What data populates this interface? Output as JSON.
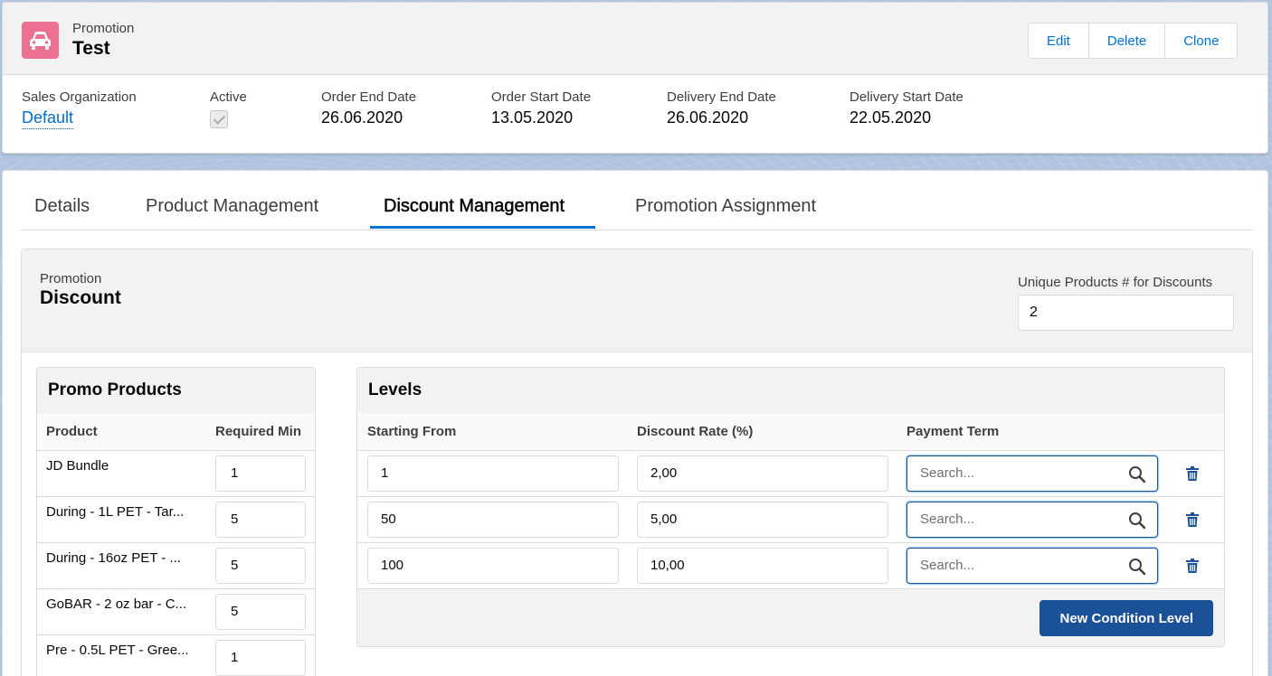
{
  "header": {
    "entity_label": "Promotion",
    "record_title": "Test",
    "icon": "car-icon",
    "icon_color": "#eb7092",
    "actions": {
      "edit": "Edit",
      "delete": "Delete",
      "clone": "Clone"
    },
    "fields": {
      "sales_org_label": "Sales Organization",
      "sales_org_value": "Default",
      "active_label": "Active",
      "active_checked": true,
      "order_end_label": "Order End Date",
      "order_end_value": "26.06.2020",
      "order_start_label": "Order Start Date",
      "order_start_value": "13.05.2020",
      "delivery_end_label": "Delivery End Date",
      "delivery_end_value": "26.06.2020",
      "delivery_start_label": "Delivery Start Date",
      "delivery_start_value": "22.05.2020"
    }
  },
  "tabs": {
    "details": "Details",
    "product_management": "Product Management",
    "discount_management": "Discount Management",
    "promotion_assignment": "Promotion Assignment",
    "active": "discount_management"
  },
  "discount": {
    "label": "Promotion",
    "title": "Discount",
    "unique_products_label": "Unique Products # for Discounts",
    "unique_products_value": "2"
  },
  "promo_products": {
    "title": "Promo Products",
    "col_product": "Product",
    "col_required_min": "Required Min",
    "rows": [
      {
        "name": "JD Bundle",
        "min": "1"
      },
      {
        "name": "During - 1L PET - Tar...",
        "min": "5"
      },
      {
        "name": "During - 16oz PET - ...",
        "min": "5"
      },
      {
        "name": "GoBAR - 2 oz bar - C...",
        "min": "5"
      },
      {
        "name": "Pre - 0.5L PET - Gree...",
        "min": "1"
      }
    ]
  },
  "levels": {
    "title": "Levels",
    "col_starting_from": "Starting From",
    "col_discount_rate": "Discount Rate (%)",
    "col_payment_term": "Payment Term",
    "search_placeholder": "Search...",
    "rows": [
      {
        "starting_from": "1",
        "discount_rate": "2,00"
      },
      {
        "starting_from": "50",
        "discount_rate": "5,00"
      },
      {
        "starting_from": "100",
        "discount_rate": "10,00"
      }
    ],
    "new_button": "New Condition Level"
  },
  "colors": {
    "link": "#006dcc",
    "active_tab": "#0070d2",
    "brand_button": "#1b5297"
  }
}
